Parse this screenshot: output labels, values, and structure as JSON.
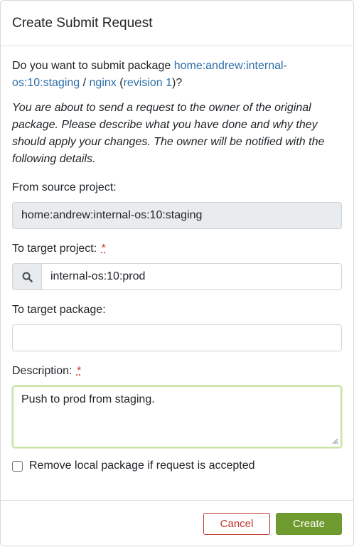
{
  "dialog": {
    "title": "Create Submit Request",
    "question": {
      "prefix": "Do you want to submit package ",
      "project_link": "home:andrew:internal-os:10:staging",
      "sep": " / ",
      "package_link": "nginx",
      "paren_open": " (",
      "revision_link": "revision 1",
      "suffix": ")?"
    },
    "info": "You are about to send a request to the owner of the original package. Please describe what you have done and why they should apply your changes. The owner will be notified with the following details.",
    "source_project": {
      "label": "From source project:",
      "value": "home:andrew:internal-os:10:staging"
    },
    "target_project": {
      "label": "To target project:",
      "required": "*",
      "value": "internal-os:10:prod"
    },
    "target_package": {
      "label": "To target package:",
      "value": ""
    },
    "description": {
      "label": "Description:",
      "required": "*",
      "value": "Push to prod from staging."
    },
    "remove_local": {
      "label": "Remove local package if request is accepted",
      "checked": false
    },
    "buttons": {
      "cancel": "Cancel",
      "create": "Create"
    }
  },
  "colors": {
    "link": "#2f6fa7",
    "danger": "#c0392b",
    "primary": "#6e9a2f",
    "focus": "#c9e3a2"
  },
  "icons": {
    "search": "search-icon",
    "resize": "resize-grip-icon"
  }
}
